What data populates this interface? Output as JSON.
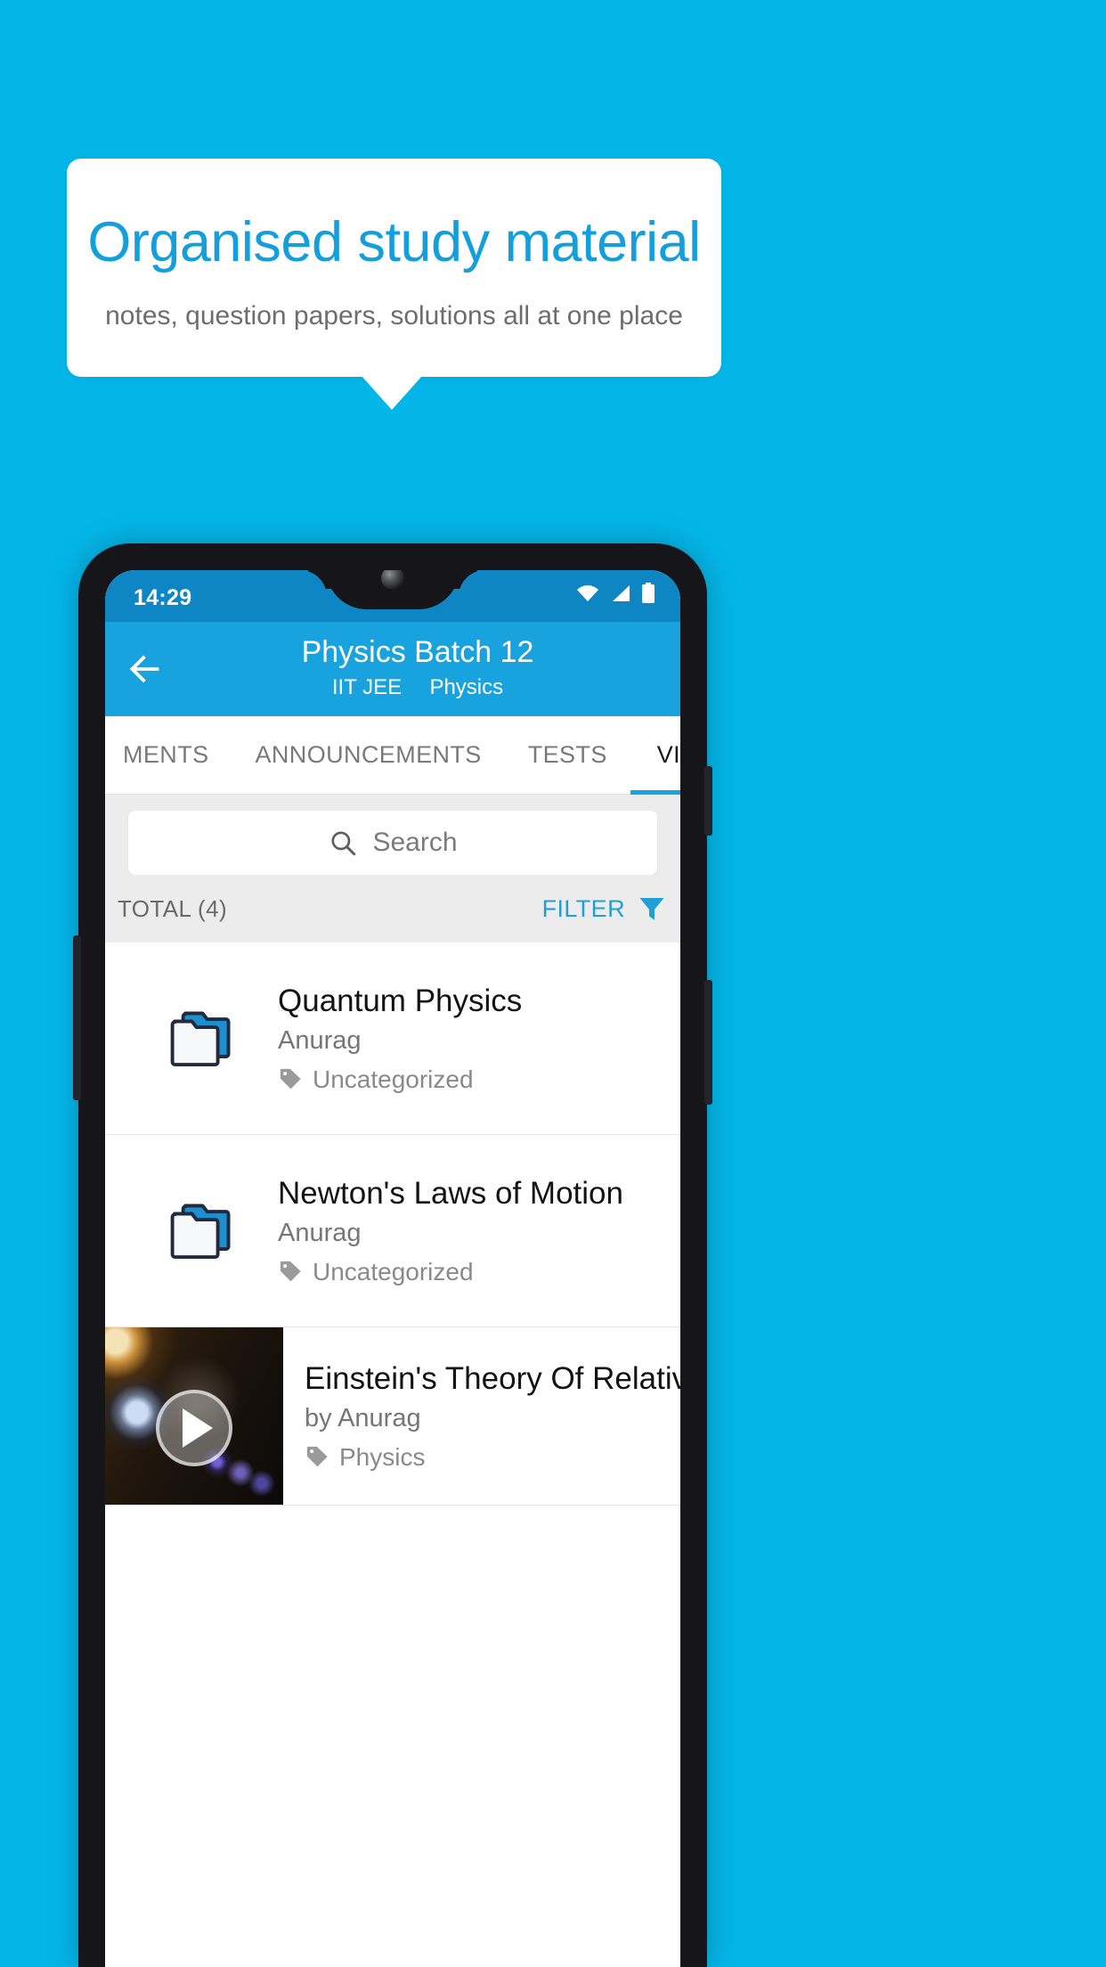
{
  "promo": {
    "title": "Organised study material",
    "subtitle": "notes, question papers, solutions all at one place",
    "accent_color": "#139fdc",
    "background_color": "#04b6e8"
  },
  "phone": {
    "status_bar": {
      "time": "14:29",
      "icons": [
        "wifi-icon",
        "signal-icon",
        "battery-icon"
      ],
      "background_color": "#0e86c4"
    },
    "app_bar": {
      "back_icon": "back-arrow-icon",
      "title": "Physics Batch 12",
      "subtitle_exam": "IIT JEE",
      "subtitle_subject": "Physics",
      "background_color": "#18a2de"
    },
    "tabs": [
      {
        "label": "MENTS",
        "active": false
      },
      {
        "label": "ANNOUNCEMENTS",
        "active": false
      },
      {
        "label": "TESTS",
        "active": false
      },
      {
        "label": "VIDEOS",
        "active": true
      }
    ],
    "search": {
      "icon": "search-icon",
      "placeholder": "Search",
      "value": ""
    },
    "toolbar": {
      "total_label": "TOTAL (4)",
      "filter_label": "FILTER",
      "filter_icon": "filter-funnel-icon",
      "filter_color": "#1f9fd6"
    },
    "list": [
      {
        "type": "folder",
        "icon": "folder-icon",
        "title": "Quantum Physics",
        "author": "Anurag",
        "tag_icon": "tag-icon",
        "tag": "Uncategorized"
      },
      {
        "type": "folder",
        "icon": "folder-icon",
        "title": "Newton's Laws of Motion",
        "author": "Anurag",
        "tag_icon": "tag-icon",
        "tag": "Uncategorized"
      },
      {
        "type": "video",
        "icon": "play-icon",
        "title": "Einstein's Theory Of Relativity",
        "author": "by Anurag",
        "tag_icon": "tag-icon",
        "tag": "Physics"
      }
    ]
  }
}
